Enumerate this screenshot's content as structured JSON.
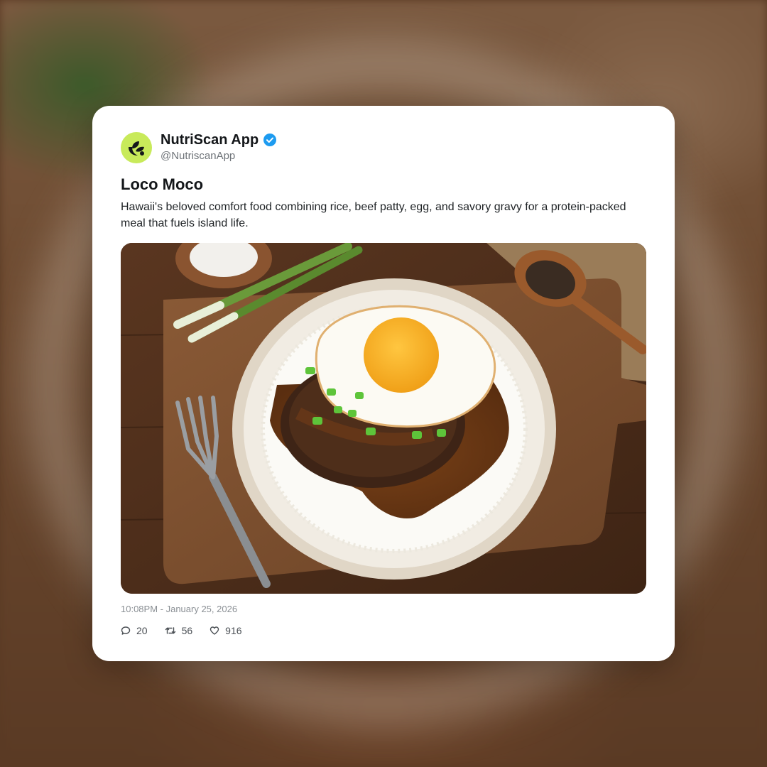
{
  "post": {
    "display_name": "NutriScan App",
    "handle": "@NutriscanApp",
    "verified": true,
    "verified_color": "#1d9bf0",
    "avatar_color": "#c8ea5a",
    "avatar_icon": "leaf-logo-icon",
    "title": "Loco Moco",
    "description": "Hawaii's beloved comfort food combining rice, beef patty, egg, and savory gravy for a protein-packed meal that fuels island life.",
    "timestamp": "10:08PM - January 25, 2026",
    "stats": {
      "replies": "20",
      "reposts": "56",
      "likes": "916"
    }
  },
  "icons": {
    "reply": "speech-bubble-icon",
    "repost": "repost-arrows-icon",
    "like": "heart-icon"
  }
}
